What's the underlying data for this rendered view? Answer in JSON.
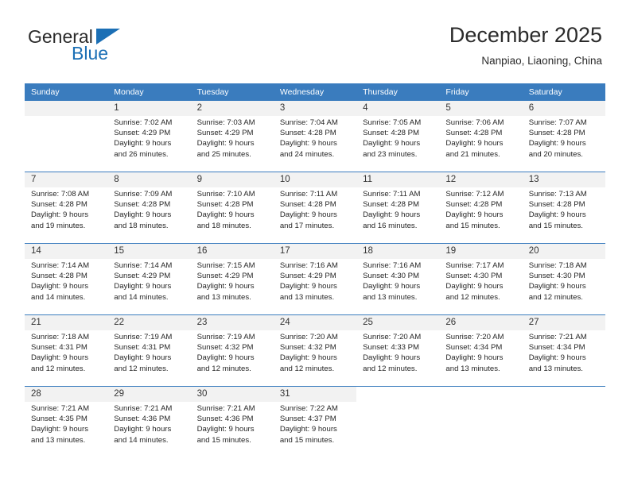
{
  "brand": {
    "name_part1": "General",
    "name_part2": "Blue",
    "accent_color": "#1b6fb5"
  },
  "header": {
    "title": "December 2025",
    "subtitle": "Nanpiao, Liaoning, China"
  },
  "theme": {
    "header_blue": "#3a7cbe",
    "daynum_gray": "#f2f2f2"
  },
  "weekday_headers": [
    "Sunday",
    "Monday",
    "Tuesday",
    "Wednesday",
    "Thursday",
    "Friday",
    "Saturday"
  ],
  "weeks": [
    [
      {
        "day": "",
        "blank": true,
        "sunrise": "",
        "sunset": "",
        "daylight1": "",
        "daylight2": ""
      },
      {
        "day": "1",
        "sunrise": "Sunrise: 7:02 AM",
        "sunset": "Sunset: 4:29 PM",
        "daylight1": "Daylight: 9 hours",
        "daylight2": "and 26 minutes."
      },
      {
        "day": "2",
        "sunrise": "Sunrise: 7:03 AM",
        "sunset": "Sunset: 4:29 PM",
        "daylight1": "Daylight: 9 hours",
        "daylight2": "and 25 minutes."
      },
      {
        "day": "3",
        "sunrise": "Sunrise: 7:04 AM",
        "sunset": "Sunset: 4:28 PM",
        "daylight1": "Daylight: 9 hours",
        "daylight2": "and 24 minutes."
      },
      {
        "day": "4",
        "sunrise": "Sunrise: 7:05 AM",
        "sunset": "Sunset: 4:28 PM",
        "daylight1": "Daylight: 9 hours",
        "daylight2": "and 23 minutes."
      },
      {
        "day": "5",
        "sunrise": "Sunrise: 7:06 AM",
        "sunset": "Sunset: 4:28 PM",
        "daylight1": "Daylight: 9 hours",
        "daylight2": "and 21 minutes."
      },
      {
        "day": "6",
        "sunrise": "Sunrise: 7:07 AM",
        "sunset": "Sunset: 4:28 PM",
        "daylight1": "Daylight: 9 hours",
        "daylight2": "and 20 minutes."
      }
    ],
    [
      {
        "day": "7",
        "sunrise": "Sunrise: 7:08 AM",
        "sunset": "Sunset: 4:28 PM",
        "daylight1": "Daylight: 9 hours",
        "daylight2": "and 19 minutes."
      },
      {
        "day": "8",
        "sunrise": "Sunrise: 7:09 AM",
        "sunset": "Sunset: 4:28 PM",
        "daylight1": "Daylight: 9 hours",
        "daylight2": "and 18 minutes."
      },
      {
        "day": "9",
        "sunrise": "Sunrise: 7:10 AM",
        "sunset": "Sunset: 4:28 PM",
        "daylight1": "Daylight: 9 hours",
        "daylight2": "and 18 minutes."
      },
      {
        "day": "10",
        "sunrise": "Sunrise: 7:11 AM",
        "sunset": "Sunset: 4:28 PM",
        "daylight1": "Daylight: 9 hours",
        "daylight2": "and 17 minutes."
      },
      {
        "day": "11",
        "sunrise": "Sunrise: 7:11 AM",
        "sunset": "Sunset: 4:28 PM",
        "daylight1": "Daylight: 9 hours",
        "daylight2": "and 16 minutes."
      },
      {
        "day": "12",
        "sunrise": "Sunrise: 7:12 AM",
        "sunset": "Sunset: 4:28 PM",
        "daylight1": "Daylight: 9 hours",
        "daylight2": "and 15 minutes."
      },
      {
        "day": "13",
        "sunrise": "Sunrise: 7:13 AM",
        "sunset": "Sunset: 4:28 PM",
        "daylight1": "Daylight: 9 hours",
        "daylight2": "and 15 minutes."
      }
    ],
    [
      {
        "day": "14",
        "sunrise": "Sunrise: 7:14 AM",
        "sunset": "Sunset: 4:28 PM",
        "daylight1": "Daylight: 9 hours",
        "daylight2": "and 14 minutes."
      },
      {
        "day": "15",
        "sunrise": "Sunrise: 7:14 AM",
        "sunset": "Sunset: 4:29 PM",
        "daylight1": "Daylight: 9 hours",
        "daylight2": "and 14 minutes."
      },
      {
        "day": "16",
        "sunrise": "Sunrise: 7:15 AM",
        "sunset": "Sunset: 4:29 PM",
        "daylight1": "Daylight: 9 hours",
        "daylight2": "and 13 minutes."
      },
      {
        "day": "17",
        "sunrise": "Sunrise: 7:16 AM",
        "sunset": "Sunset: 4:29 PM",
        "daylight1": "Daylight: 9 hours",
        "daylight2": "and 13 minutes."
      },
      {
        "day": "18",
        "sunrise": "Sunrise: 7:16 AM",
        "sunset": "Sunset: 4:30 PM",
        "daylight1": "Daylight: 9 hours",
        "daylight2": "and 13 minutes."
      },
      {
        "day": "19",
        "sunrise": "Sunrise: 7:17 AM",
        "sunset": "Sunset: 4:30 PM",
        "daylight1": "Daylight: 9 hours",
        "daylight2": "and 12 minutes."
      },
      {
        "day": "20",
        "sunrise": "Sunrise: 7:18 AM",
        "sunset": "Sunset: 4:30 PM",
        "daylight1": "Daylight: 9 hours",
        "daylight2": "and 12 minutes."
      }
    ],
    [
      {
        "day": "21",
        "sunrise": "Sunrise: 7:18 AM",
        "sunset": "Sunset: 4:31 PM",
        "daylight1": "Daylight: 9 hours",
        "daylight2": "and 12 minutes."
      },
      {
        "day": "22",
        "sunrise": "Sunrise: 7:19 AM",
        "sunset": "Sunset: 4:31 PM",
        "daylight1": "Daylight: 9 hours",
        "daylight2": "and 12 minutes."
      },
      {
        "day": "23",
        "sunrise": "Sunrise: 7:19 AM",
        "sunset": "Sunset: 4:32 PM",
        "daylight1": "Daylight: 9 hours",
        "daylight2": "and 12 minutes."
      },
      {
        "day": "24",
        "sunrise": "Sunrise: 7:20 AM",
        "sunset": "Sunset: 4:32 PM",
        "daylight1": "Daylight: 9 hours",
        "daylight2": "and 12 minutes."
      },
      {
        "day": "25",
        "sunrise": "Sunrise: 7:20 AM",
        "sunset": "Sunset: 4:33 PM",
        "daylight1": "Daylight: 9 hours",
        "daylight2": "and 12 minutes."
      },
      {
        "day": "26",
        "sunrise": "Sunrise: 7:20 AM",
        "sunset": "Sunset: 4:34 PM",
        "daylight1": "Daylight: 9 hours",
        "daylight2": "and 13 minutes."
      },
      {
        "day": "27",
        "sunrise": "Sunrise: 7:21 AM",
        "sunset": "Sunset: 4:34 PM",
        "daylight1": "Daylight: 9 hours",
        "daylight2": "and 13 minutes."
      }
    ],
    [
      {
        "day": "28",
        "sunrise": "Sunrise: 7:21 AM",
        "sunset": "Sunset: 4:35 PM",
        "daylight1": "Daylight: 9 hours",
        "daylight2": "and 13 minutes."
      },
      {
        "day": "29",
        "sunrise": "Sunrise: 7:21 AM",
        "sunset": "Sunset: 4:36 PM",
        "daylight1": "Daylight: 9 hours",
        "daylight2": "and 14 minutes."
      },
      {
        "day": "30",
        "sunrise": "Sunrise: 7:21 AM",
        "sunset": "Sunset: 4:36 PM",
        "daylight1": "Daylight: 9 hours",
        "daylight2": "and 15 minutes."
      },
      {
        "day": "31",
        "sunrise": "Sunrise: 7:22 AM",
        "sunset": "Sunset: 4:37 PM",
        "daylight1": "Daylight: 9 hours",
        "daylight2": "and 15 minutes."
      },
      {
        "day": "",
        "blank": true,
        "sunrise": "",
        "sunset": "",
        "daylight1": "",
        "daylight2": ""
      },
      {
        "day": "",
        "blank": true,
        "sunrise": "",
        "sunset": "",
        "daylight1": "",
        "daylight2": ""
      },
      {
        "day": "",
        "blank": true,
        "sunrise": "",
        "sunset": "",
        "daylight1": "",
        "daylight2": ""
      }
    ]
  ]
}
